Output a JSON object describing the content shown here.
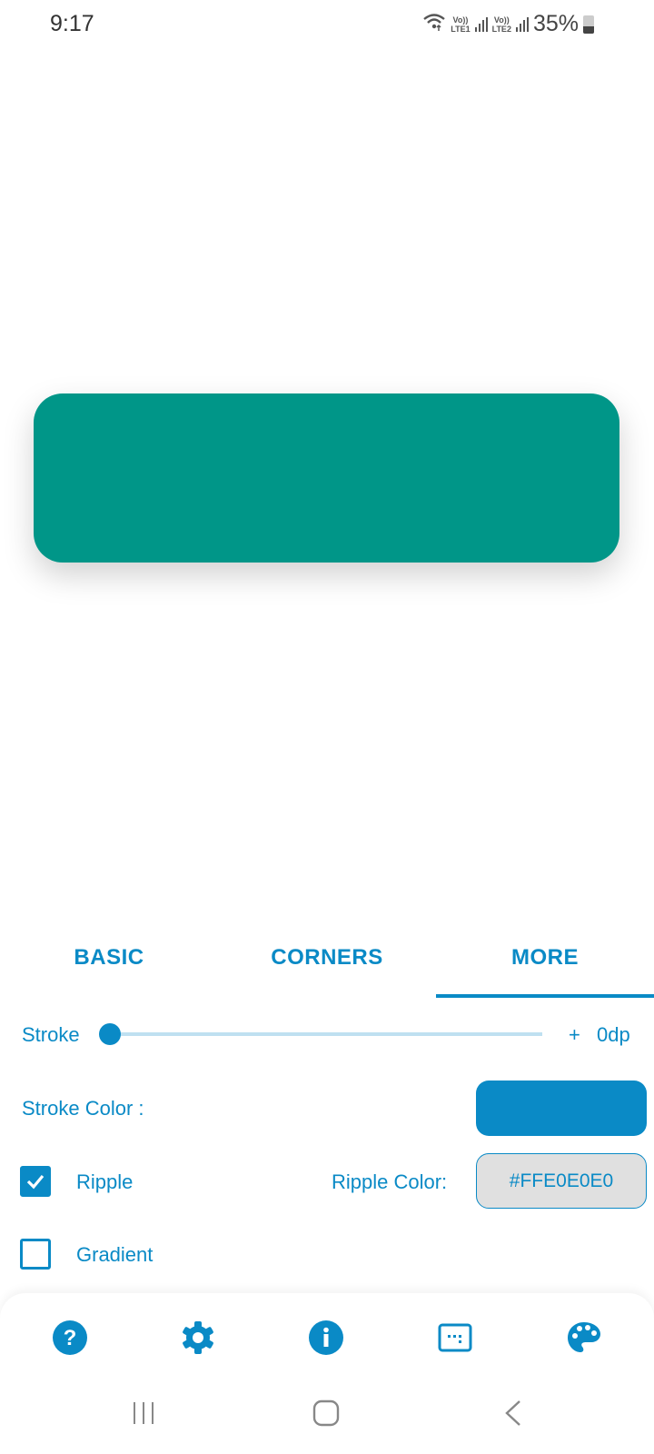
{
  "status_bar": {
    "time": "9:17",
    "sim1": {
      "top": "Vo))",
      "bottom": "LTE1"
    },
    "sim2": {
      "top": "Vo))",
      "bottom": "LTE2"
    },
    "battery_percent": "35%"
  },
  "preview": {
    "button_color": "#009688",
    "label": ""
  },
  "tabs": [
    {
      "label": "BASIC",
      "active": false
    },
    {
      "label": "CORNERS",
      "active": false
    },
    {
      "label": "MORE",
      "active": true
    }
  ],
  "more_panel": {
    "stroke": {
      "label": "Stroke",
      "value": 0,
      "plus": "+",
      "value_text": "0dp"
    },
    "stroke_color": {
      "label": "Stroke Color :",
      "color": "#0A8AC6"
    },
    "ripple": {
      "label": "Ripple",
      "checked": true,
      "color_label": "Ripple Color:",
      "color_value": "#FFE0E0E0"
    },
    "gradient": {
      "label": "Gradient",
      "checked": false
    }
  },
  "bottom_toolbar": {
    "icons": [
      "help-icon",
      "settings-icon",
      "info-icon",
      "code-view-icon",
      "palette-icon"
    ]
  },
  "nav_bar": {
    "buttons": [
      "recents-button",
      "home-button",
      "back-button"
    ]
  },
  "colors": {
    "accent": "#0A8AC6",
    "preview": "#009688",
    "slider_track": "#BFE0F1"
  }
}
